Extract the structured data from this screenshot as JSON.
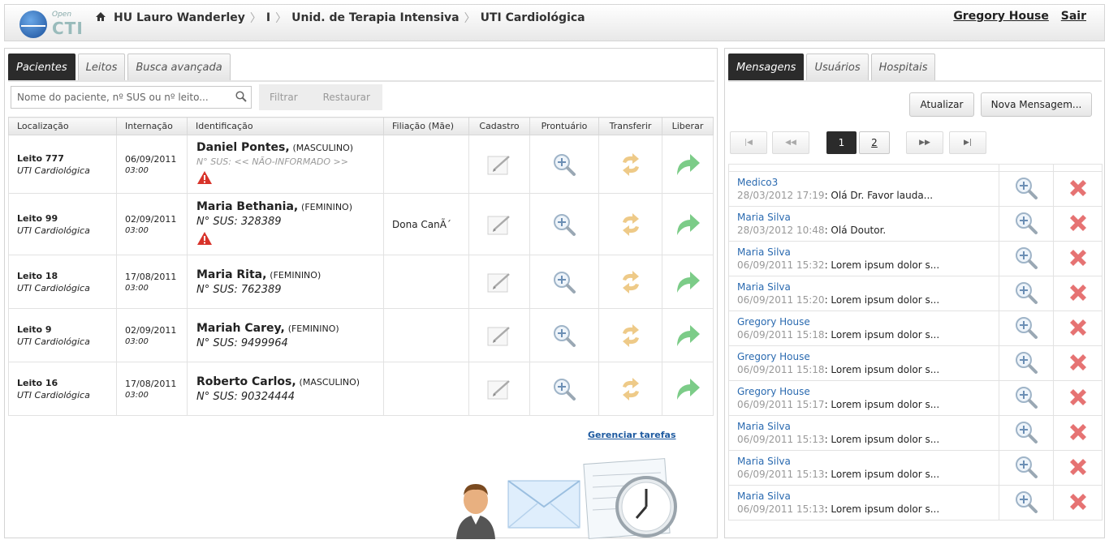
{
  "header": {
    "logo": {
      "top": "Open",
      "bottom": "CTI"
    },
    "breadcrumb": [
      "HU Lauro Wanderley",
      "I",
      "Unid. de Terapia Intensiva",
      "UTI Cardiológica"
    ],
    "user_name": "Gregory House",
    "logout_label": "Sair"
  },
  "left": {
    "tabs": [
      "Pacientes",
      "Leitos",
      "Busca avançada"
    ],
    "active_tab": 0,
    "search_placeholder": "Nome do paciente, nº SUS ou nº leito...",
    "filter_label": "Filtrar",
    "reset_label": "Restaurar",
    "columns": [
      "Localização",
      "Internação",
      "Identificação",
      "Filiação (Mãe)",
      "Cadastro",
      "Prontuário",
      "Transferir",
      "Liberar"
    ],
    "patients": [
      {
        "bed": "Leito 777",
        "unit": "UTI Cardiológica",
        "date": "06/09/2011",
        "time": "03:00",
        "name": "Daniel Pontes,",
        "sex": "(MASCULINO)",
        "sus": "N° SUS: << NÃO-INFORMADO >>",
        "sus_missing": true,
        "warning": true,
        "mother": ""
      },
      {
        "bed": "Leito 99",
        "unit": "UTI Cardiológica",
        "date": "02/09/2011",
        "time": "03:00",
        "name": "Maria Bethania,",
        "sex": "(FEMININO)",
        "sus": "N° SUS: 328389",
        "sus_missing": false,
        "warning": true,
        "mother": "Dona CanÃ´"
      },
      {
        "bed": "Leito 18",
        "unit": "UTI Cardiológica",
        "date": "17/08/2011",
        "time": "03:00",
        "name": "Maria Rita,",
        "sex": "(FEMININO)",
        "sus": "N° SUS: 762389",
        "sus_missing": false,
        "warning": false,
        "mother": ""
      },
      {
        "bed": "Leito 9",
        "unit": "UTI Cardiológica",
        "date": "02/09/2011",
        "time": "03:00",
        "name": "Mariah Carey,",
        "sex": "(FEMININO)",
        "sus": "N° SUS: 9499964",
        "sus_missing": false,
        "warning": false,
        "mother": ""
      },
      {
        "bed": "Leito 16",
        "unit": "UTI Cardiológica",
        "date": "17/08/2011",
        "time": "03:00",
        "name": "Roberto Carlos,",
        "sex": "(MASCULINO)",
        "sus": "N° SUS: 90324444",
        "sus_missing": false,
        "warning": false,
        "mother": ""
      }
    ],
    "manage_tasks_label": "Gerenciar tarefas"
  },
  "right": {
    "tabs": [
      "Mensagens",
      "Usuários",
      "Hospitais"
    ],
    "active_tab": 0,
    "refresh_label": "Atualizar",
    "new_message_label": "Nova Mensagem...",
    "pager": {
      "first": "|◀",
      "prev": "◀◀",
      "pages": [
        "1",
        "2"
      ],
      "current": 0,
      "next": "▶▶",
      "last": "▶|"
    },
    "messages": [
      {
        "sender": "Medico3",
        "date": "28/03/2012 17:19",
        "text": ": Olá Dr. Favor lauda..."
      },
      {
        "sender": "Maria Silva",
        "date": "28/03/2012 10:48",
        "text": ": Olá Doutor."
      },
      {
        "sender": "Maria Silva",
        "date": "06/09/2011 15:32",
        "text": ": Lorem ipsum dolor s..."
      },
      {
        "sender": "Maria Silva",
        "date": "06/09/2011 15:20",
        "text": ": Lorem ipsum dolor s..."
      },
      {
        "sender": "Gregory House",
        "date": "06/09/2011 15:18",
        "text": ": Lorem ipsum dolor s..."
      },
      {
        "sender": "Gregory House",
        "date": "06/09/2011 15:18",
        "text": ": Lorem ipsum dolor s..."
      },
      {
        "sender": "Gregory House",
        "date": "06/09/2011 15:17",
        "text": ": Lorem ipsum dolor s..."
      },
      {
        "sender": "Maria Silva",
        "date": "06/09/2011 15:13",
        "text": ": Lorem ipsum dolor s..."
      },
      {
        "sender": "Maria Silva",
        "date": "06/09/2011 15:13",
        "text": ": Lorem ipsum dolor s..."
      },
      {
        "sender": "Maria Silva",
        "date": "06/09/2011 15:13",
        "text": ": Lorem ipsum dolor s..."
      }
    ]
  },
  "colors": {
    "active_tab": "#2b2b2b",
    "link": "#2a6ab0",
    "delete": "#e05050",
    "release": "#5bbf6a",
    "transfer": "#e8b860"
  }
}
